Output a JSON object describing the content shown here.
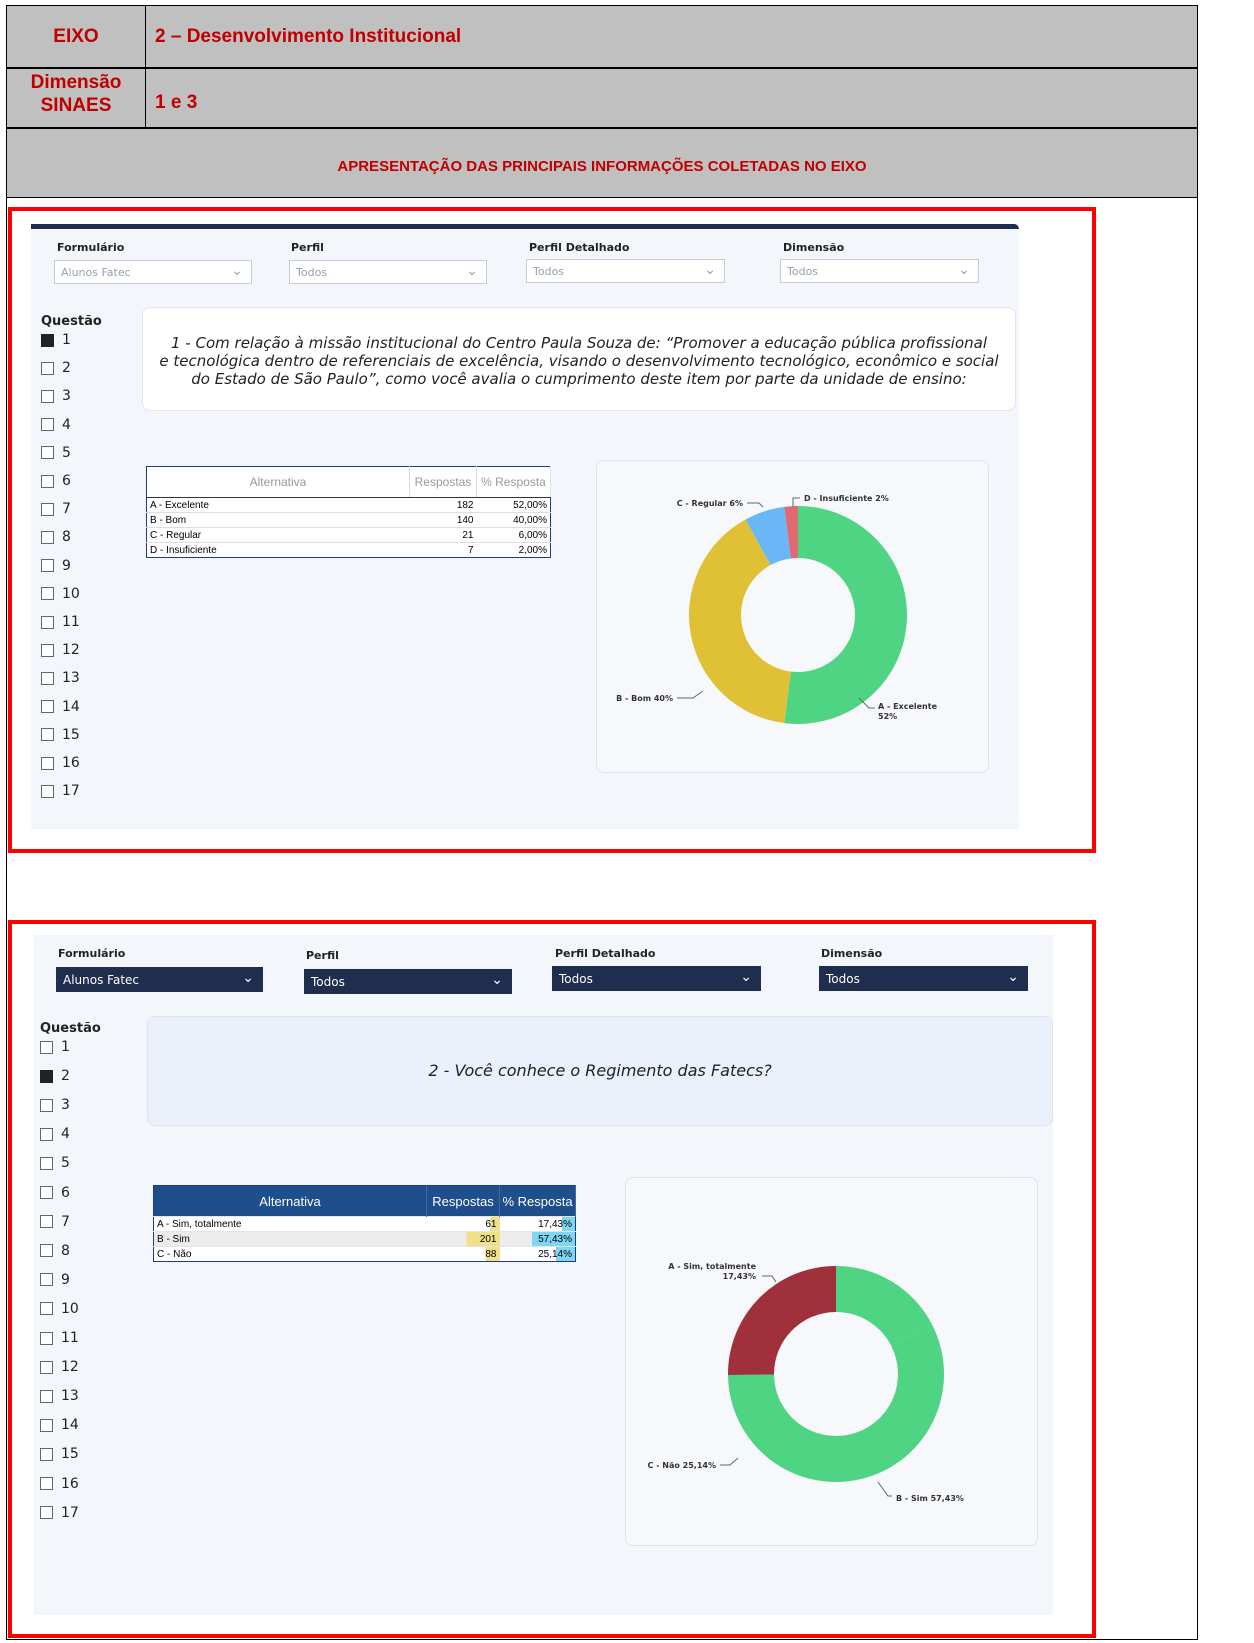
{
  "header": {
    "eixo_label": "EIXO",
    "eixo_value": "2 – Desenvolvimento Institucional",
    "dimensao_label_1": "Dimensão",
    "dimensao_label_2": "SINAES",
    "dimensao_value": "1 e 3",
    "section_title": "APRESENTAÇÃO DAS PRINCIPAIS INFORMAÇÕES COLETADAS NO EIXO"
  },
  "filters": {
    "labels": [
      "Formulário",
      "Perfil",
      "Perfil Detalhado",
      "Dimensão"
    ],
    "values": [
      "Alunos Fatec",
      "Todos",
      "Todos",
      "Todos"
    ]
  },
  "questions": {
    "title": "Questão",
    "items": [
      "1",
      "2",
      "3",
      "4",
      "5",
      "6",
      "7",
      "8",
      "9",
      "10",
      "11",
      "12",
      "13",
      "14",
      "15",
      "16",
      "17"
    ]
  },
  "panel1": {
    "selected": "1",
    "question_line1": "1 - Com relação à missão institucional do Centro Paula Souza de: “Promover a educação pública profissional",
    "question_line2": "e tecnológica dentro de referenciais de excelência, visando o desenvolvimento tecnológico, econômico e social",
    "question_line3": "do Estado de São Paulo”, como você avalia o cumprimento deste item por parte da unidade de ensino:",
    "table": {
      "headers": [
        "Alternativa",
        "Respostas",
        "% Resposta"
      ],
      "rows": [
        [
          "A - Excelente",
          "182",
          "52,00%"
        ],
        [
          "B - Bom",
          "140",
          "40,00%"
        ],
        [
          "C - Regular",
          "21",
          "6,00%"
        ],
        [
          "D - Insuficiente",
          "7",
          "2,00%"
        ]
      ]
    },
    "labels": [
      "A - Excelente",
      "52%",
      "B - Bom 40%",
      "C - Regular 6%",
      "D - Insuficiente 2%"
    ]
  },
  "panel2": {
    "selected": "2",
    "question": "2 - Você conhece o Regimento das Fatecs?",
    "table": {
      "headers": [
        "Alternativa",
        "Respostas",
        "% Resposta"
      ],
      "rows": [
        [
          "A - Sim, totalmente",
          "61",
          "17,43%"
        ],
        [
          "B - Sim",
          "201",
          "57,43%"
        ],
        [
          "C - Não",
          "88",
          "25,14%"
        ]
      ]
    },
    "labels": [
      "A - Sim, totalmente",
      "17,43%",
      "B - Sim 57,43%",
      "C - Não 25,14%"
    ]
  },
  "chart_data": [
    {
      "type": "pie",
      "categories": [
        "A - Excelente",
        "B - Bom",
        "C - Regular",
        "D - Insuficiente"
      ],
      "values": [
        52,
        40,
        6,
        2
      ],
      "colors": [
        "#4fd483",
        "#e0c034",
        "#6ab7f7",
        "#e06a72"
      ]
    },
    {
      "type": "pie",
      "categories": [
        "A - Sim, totalmente",
        "B - Sim",
        "C - Não"
      ],
      "values": [
        17.43,
        57.43,
        25.14
      ],
      "colors": [
        "#4fd483",
        "#4fd483",
        "#a0303c"
      ]
    }
  ]
}
